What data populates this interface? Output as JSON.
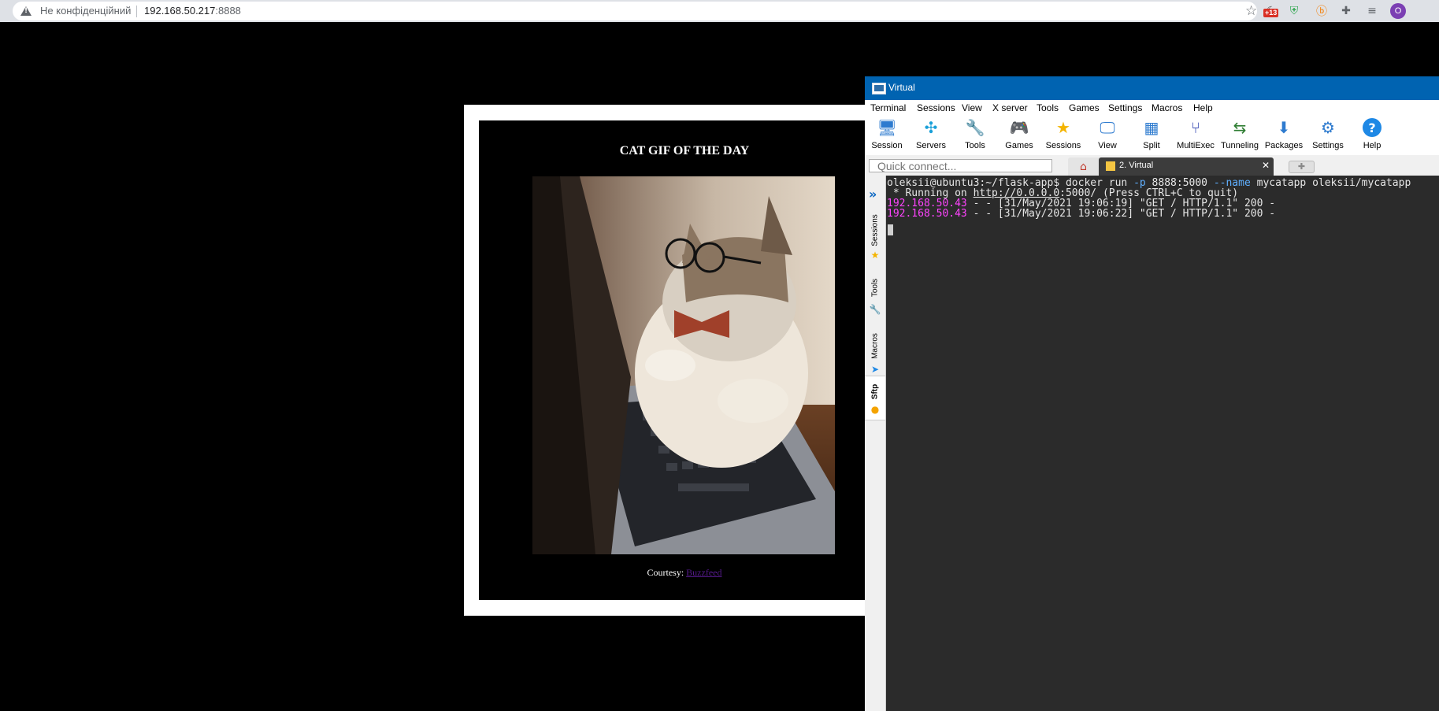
{
  "browser": {
    "security_label": "Не конфіденційний",
    "url_host": "192.168.50.217",
    "url_port": ":8888",
    "extension_badge": "+13",
    "profile_initial": "O"
  },
  "page": {
    "title": "CAT GIF OF THE DAY",
    "courtesy_label": "Courtesy: ",
    "courtesy_link": "Buzzfeed"
  },
  "moba": {
    "window_title": "Virtual",
    "menu": [
      "Terminal",
      "Sessions",
      "View",
      "X server",
      "Tools",
      "Games",
      "Settings",
      "Macros",
      "Help"
    ],
    "toolbar": [
      {
        "label": "Session",
        "icon": "session-icon",
        "glyph": "🖥",
        "color": "#2e7bcf"
      },
      {
        "label": "Servers",
        "icon": "servers-icon",
        "glyph": "✣",
        "color": "#1aa0d8"
      },
      {
        "label": "Tools",
        "icon": "tools-icon",
        "glyph": "🔧",
        "color": "#d9342b"
      },
      {
        "label": "Games",
        "icon": "games-icon",
        "glyph": "🎮",
        "color": "#555555"
      },
      {
        "label": "Sessions",
        "icon": "star-icon",
        "glyph": "★",
        "color": "#f4b400"
      },
      {
        "label": "View",
        "icon": "view-icon",
        "glyph": "🖵",
        "color": "#2e7bcf"
      },
      {
        "label": "Split",
        "icon": "split-icon",
        "glyph": "▦",
        "color": "#2e7bcf"
      },
      {
        "label": "MultiExec",
        "icon": "multiexec-icon",
        "glyph": "⑂",
        "color": "#3f51b5"
      },
      {
        "label": "Tunneling",
        "icon": "tunneling-icon",
        "glyph": "⇆",
        "color": "#2e7d32"
      },
      {
        "label": "Packages",
        "icon": "packages-icon",
        "glyph": "⬇",
        "color": "#2e7bcf"
      },
      {
        "label": "Settings",
        "icon": "settings-icon",
        "glyph": "⚙",
        "color": "#2e7bcf"
      },
      {
        "label": "Help",
        "icon": "help-icon",
        "glyph": "?",
        "color": "#1e88e5"
      }
    ],
    "quick_connect_placeholder": "Quick connect...",
    "session_tab": "2. Virtual",
    "sidebar_tabs": [
      "Sessions",
      "Tools",
      "Macros",
      "Sftp"
    ],
    "terminal": {
      "line1_prompt": "oleksii@ubuntu3:~/flask-app$ docker run ",
      "line1_flag_p": "-p",
      "line1_port": " 8888:5000 ",
      "line1_flag_name": "--name",
      "line1_rest": " mycatapp oleksii/mycatapp",
      "line2_pre": " * Running on ",
      "line2_url": "http://0.0.0.0",
      "line2_post": ":5000/ (Press CTRL+C to quit)",
      "log_ip": "192.168.50.43",
      "log1": " - - [31/May/2021 19:06:19] \"GET / HTTP/1.1\" 200 -",
      "log2": " - - [31/May/2021 19:06:22] \"GET / HTTP/1.1\" 200 -"
    }
  }
}
